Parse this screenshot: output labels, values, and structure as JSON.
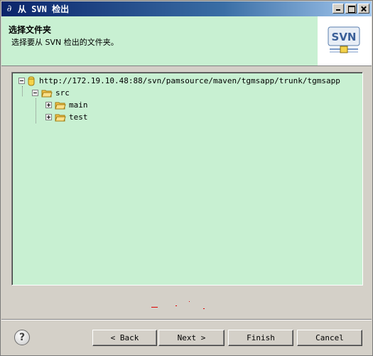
{
  "window": {
    "title": "从 SVN 检出"
  },
  "banner": {
    "title": "选择文件夹",
    "description": "选择要从 SVN 检出的文件夹。",
    "logo_text": "SVN"
  },
  "tree": {
    "root": "http://172.19.10.48:88/svn/pamsource/maven/tgmsapp/trunk/tgmsapp",
    "child": "src",
    "grandchildren": [
      "main",
      "test"
    ]
  },
  "buttons": {
    "back": "< Back",
    "next": "Next >",
    "finish": "Finish",
    "cancel": "Cancel",
    "help": "?"
  },
  "colors": {
    "panel_bg": "#c8f0d2",
    "title_bar": "#0a246a",
    "folder": "#f5c24a"
  }
}
